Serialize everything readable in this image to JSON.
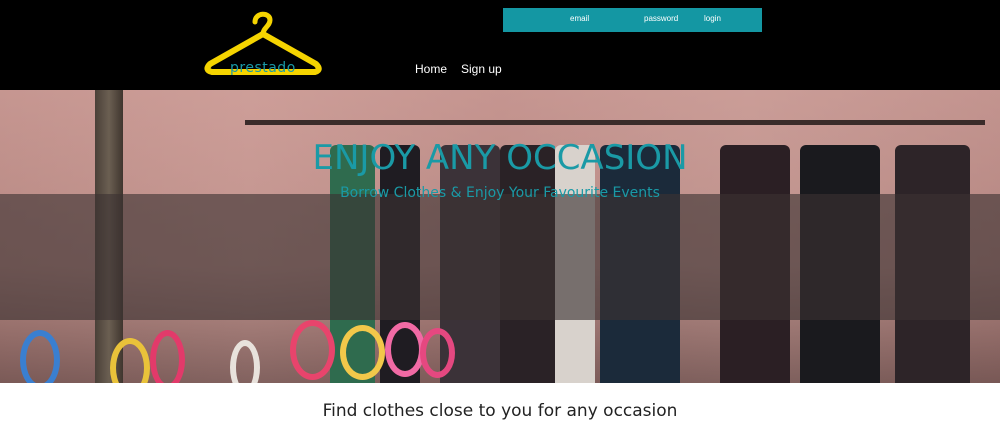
{
  "logo": {
    "text": "prestado",
    "icon": "hanger-icon",
    "color": "#f5d400"
  },
  "login": {
    "email_label": "email",
    "password_label": "password",
    "login_label": "login",
    "bar_color": "#1497a3"
  },
  "nav": {
    "home": "Home",
    "signup": "Sign up"
  },
  "hero": {
    "title": "ENJOY ANY OCCASION",
    "subtitle": "Borrow Clothes & Enjoy Your Favourite Events",
    "accent": "#1a9aa6"
  },
  "tagline": "Find clothes close to you for any occasion"
}
